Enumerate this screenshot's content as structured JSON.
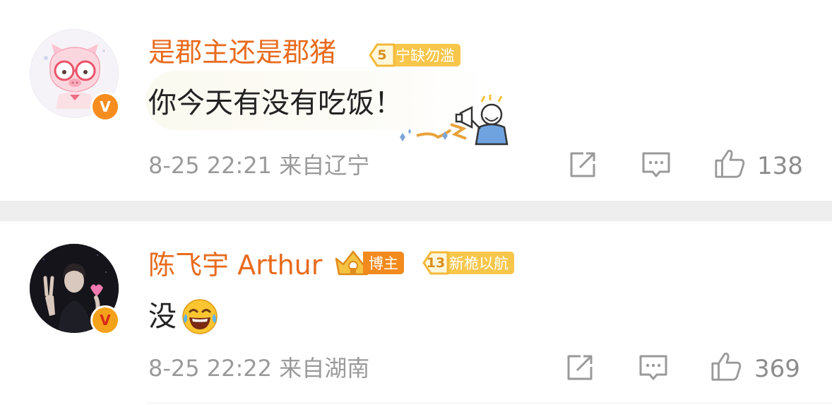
{
  "comments": [
    {
      "username": "是郡主还是郡猪",
      "fan_level": "5",
      "fan_badge_label": "宁缺勿滥",
      "text": "你今天有没有吃饭！",
      "sticker": "megaphone-shouting-sticker",
      "timestamp": "8-25 22:21",
      "location": "来自辽宁",
      "likes": "138",
      "avatar": "pink-pig-with-glasses-avatar",
      "verified_badge": "V"
    },
    {
      "username": "陈飞宇 Arthur",
      "blogger_badge_label": "博主",
      "fan_level": "13",
      "fan_badge_label": "新桅以航",
      "text": "没",
      "emoji": "laughing-tears-emoji",
      "timestamp": "8-25 22:22",
      "location": "来自湖南",
      "likes": "369",
      "avatar": "person-peace-sign-avatar",
      "verified_badge": "V"
    }
  ],
  "icons": {
    "share": "share-icon",
    "reply": "comment-icon",
    "like": "thumbs-up-icon"
  },
  "colors": {
    "username": "#e86b1c",
    "level_badge": "#f7c64a",
    "blogger_badge": "#f28a1d",
    "meta_text": "#9a9a9a"
  }
}
